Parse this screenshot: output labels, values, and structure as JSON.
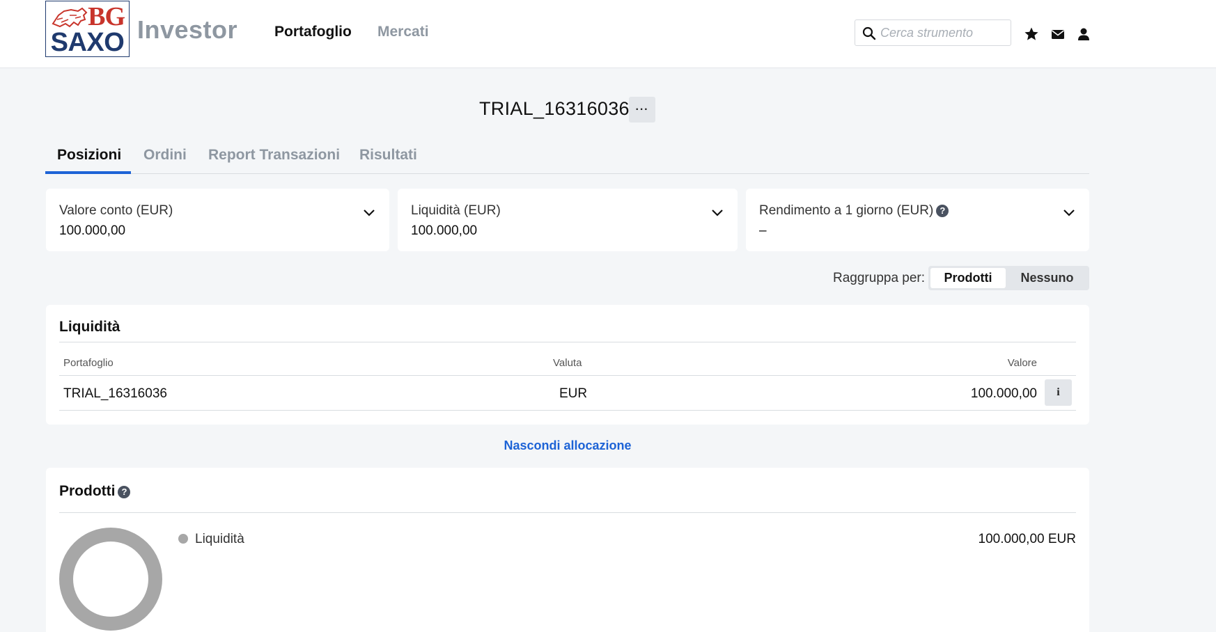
{
  "header": {
    "logo_top": "BG",
    "logo_bottom": "SAXO",
    "brand": "Investor",
    "nav": {
      "portfolio": "Portafoglio",
      "markets": "Mercati"
    },
    "search": {
      "placeholder": "Cerca strumento",
      "value": ""
    },
    "icons": [
      "search-icon",
      "star-icon",
      "mail-icon",
      "user-icon"
    ]
  },
  "account": {
    "title": "TRIAL_16316036",
    "more_label": "···"
  },
  "tabs": [
    {
      "label": "Posizioni",
      "active": true
    },
    {
      "label": "Ordini",
      "active": false
    },
    {
      "label": "Report Transazioni",
      "active": false
    },
    {
      "label": "Risultati",
      "active": false
    }
  ],
  "summary": {
    "account_value": {
      "label": "Valore conto (EUR)",
      "value": "100.000,00"
    },
    "liquidity": {
      "label": "Liquidità (EUR)",
      "value": "100.000,00"
    },
    "daily_return": {
      "label": "Rendimento a 1 giorno (EUR)",
      "value": "–",
      "help": "?"
    }
  },
  "group_by": {
    "label": "Raggruppa per:",
    "options": [
      "Prodotti",
      "Nessuno"
    ],
    "selected": "Prodotti"
  },
  "liquidity_panel": {
    "title": "Liquidità",
    "columns": {
      "portfolio": "Portafoglio",
      "currency": "Valuta",
      "value": "Valore"
    },
    "rows": [
      {
        "portfolio": "TRIAL_16316036",
        "currency": "EUR",
        "value": "100.000,00",
        "info": "i"
      }
    ]
  },
  "hide_allocation": "Nascondi allocazione",
  "products_panel": {
    "title": "Prodotti",
    "help": "?",
    "legend": [
      {
        "label": "Liquidità",
        "value": "100.000,00 EUR",
        "share": 1.0
      }
    ]
  },
  "colors": {
    "accent": "#1d63d6",
    "logo_red": "#c8342b",
    "logo_blue": "#1f3a6e",
    "donut": "#a7a7a7"
  }
}
